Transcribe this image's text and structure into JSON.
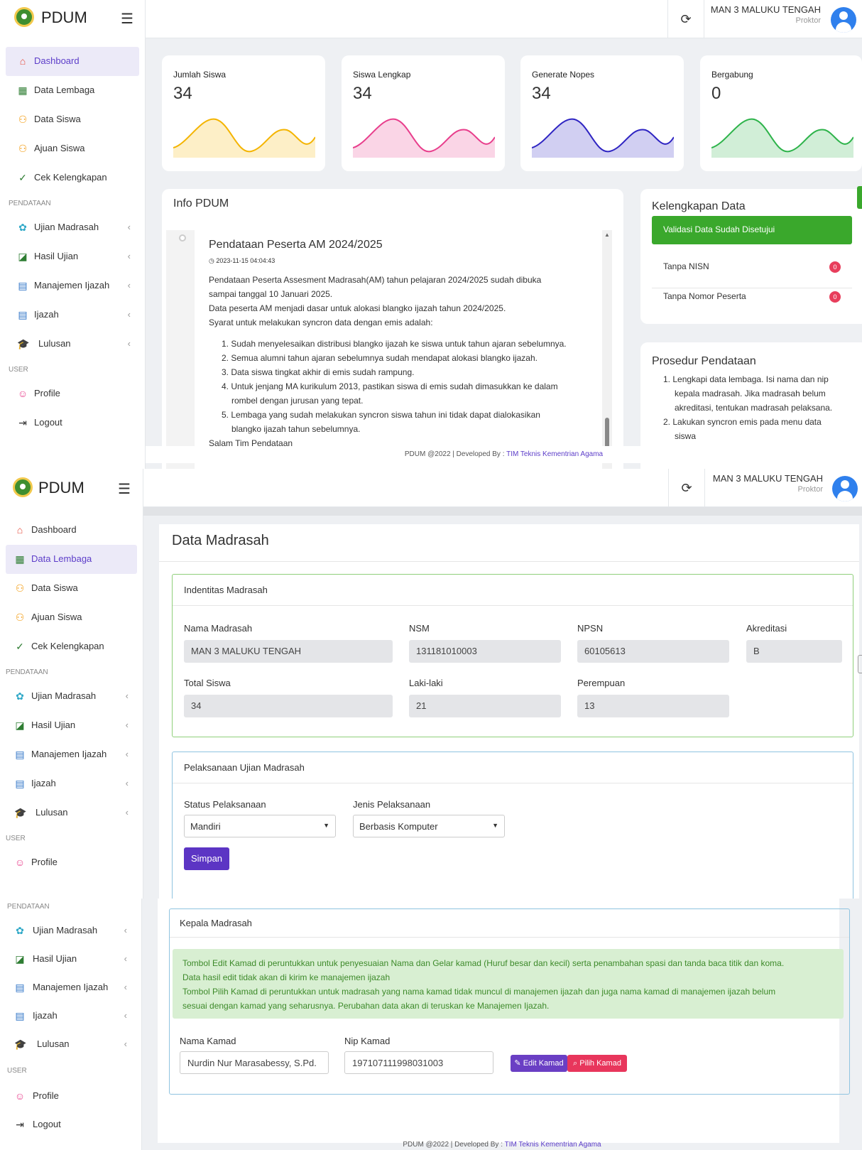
{
  "app": {
    "name": "PDUM",
    "user_name": "MAN 3 MALUKU TENGAH",
    "user_role": "Proktor"
  },
  "nav": {
    "dashboard": "Dashboard",
    "data_lembaga": "Data Lembaga",
    "data_siswa": "Data Siswa",
    "ajuan_siswa": "Ajuan Siswa",
    "cek_kelengkapan": "Cek Kelengkapan",
    "section_pendataan": "PENDATAAN",
    "ujian_madrasah": "Ujian Madrasah",
    "hasil_ujian": "Hasil Ujian",
    "manajemen_ijazah": "Manajemen Ijazah",
    "ijazah": "Ijazah",
    "lulusan": "Lulusan",
    "section_user": "USER",
    "profile": "Profile",
    "logout": "Logout"
  },
  "stats": [
    {
      "label": "Jumlah Siswa",
      "value": "34",
      "color": "#f4b400"
    },
    {
      "label": "Siswa Lengkap",
      "value": "34",
      "color": "#e83e8c"
    },
    {
      "label": "Generate Nopes",
      "value": "34",
      "color": "#2e24c2"
    },
    {
      "label": "Bergabung",
      "value": "0",
      "color": "#2db34a"
    }
  ],
  "info": {
    "title": "Info PDUM",
    "post_title": "Pendataan Peserta AM 2024/2025",
    "post_date": "2023-11-15 04:04:43",
    "p1": "Pendataan Peserta Assesment Madrasah(AM) tahun pelajaran 2024/2025 sudah dibuka",
    "p2": "sampai tanggal 10 Januari 2025.",
    "p3": "Data peserta AM menjadi dasar untuk alokasi blangko ijazah tahun 2024/2025.",
    "p4": "Syarat untuk melakukan syncron data dengan emis adalah:",
    "items": [
      "1. Sudah menyelesaikan distribusi blangko ijazah ke siswa untuk tahun ajaran sebelumnya.",
      "2. Semua alumni tahun ajaran sebelumnya sudah mendapat alokasi blangko ijazah.",
      "3. Data siswa tingkat akhir di emis sudah rampung.",
      "4. Untuk jenjang MA kurikulum 2013, pastikan siswa di emis sudah dimasukkan ke dalam",
      "rombel dengan jurusan yang tepat.",
      "5. Lembaga yang sudah melakukan syncron siswa tahun ini tidak dapat dialokasikan",
      "blangko ijazah tahun sebelumnya."
    ],
    "closing": "Salam Tim Pendataan"
  },
  "kelengkapan": {
    "title": "Kelengkapan Data",
    "banner": "Validasi Data Sudah Disetujui",
    "row1": "Tanpa NISN",
    "row1_count": "0",
    "row2": "Tanpa Nomor Peserta",
    "row2_count": "0"
  },
  "prosedur": {
    "title": "Prosedur Pendataan",
    "lines": [
      "1. Lengkapi data lembaga. Isi nama dan nip",
      "kepala madrasah. Jika madrasah belum",
      "akreditasi, tentukan madrasah pelaksana.",
      "2. Lakukan syncron emis pada menu data",
      "siswa"
    ]
  },
  "footer": {
    "text": "PDUM @2022 | Developed By : ",
    "link": "TIM Teknis Kementrian Agama"
  },
  "madrasah": {
    "page_title": "Data Madrasah",
    "identitas_title": "Indentitas Madrasah",
    "nama_label": "Nama Madrasah",
    "nama": "MAN 3 MALUKU TENGAH",
    "nsm_label": "NSM",
    "nsm": "131181010003",
    "npsn_label": "NPSN",
    "npsn": "60105613",
    "akreditasi_label": "Akreditasi",
    "akreditasi": "B",
    "total_label": "Total Siswa",
    "total": "34",
    "laki_label": "Laki-laki",
    "laki": "21",
    "perempuan_label": "Perempuan",
    "perempuan": "13"
  },
  "pelaksanaan": {
    "title": "Pelaksanaan Ujian Madrasah",
    "status_label": "Status Pelaksanaan",
    "status_value": "Mandiri",
    "jenis_label": "Jenis Pelaksanaan",
    "jenis_value": "Berbasis Komputer",
    "save": "Simpan"
  },
  "kepala": {
    "title": "Kepala Madrasah",
    "notice": [
      "Tombol Edit Kamad di peruntukkan untuk penyesuaian Nama dan Gelar kamad (Huruf besar dan kecil) serta penambahan spasi dan tanda baca titik dan koma.",
      "Data hasil edit tidak akan di kirim ke manajemen ijazah",
      "Tombol Pilih Kamad di peruntukkan untuk madrasah yang nama kamad tidak muncul di manajemen ijazah dan juga nama kamad di manajemen ijazah belum",
      "sesuai dengan kamad yang seharusnya. Perubahan data akan di teruskan ke Manajemen Ijazah."
    ],
    "nama_label": "Nama Kamad",
    "nama": "Nurdin Nur Marasabessy, S.Pd.",
    "nip_label": "Nip Kamad",
    "nip": "197107111998031003",
    "edit": "Edit Kamad",
    "pilih": "Pilih Kamad"
  }
}
